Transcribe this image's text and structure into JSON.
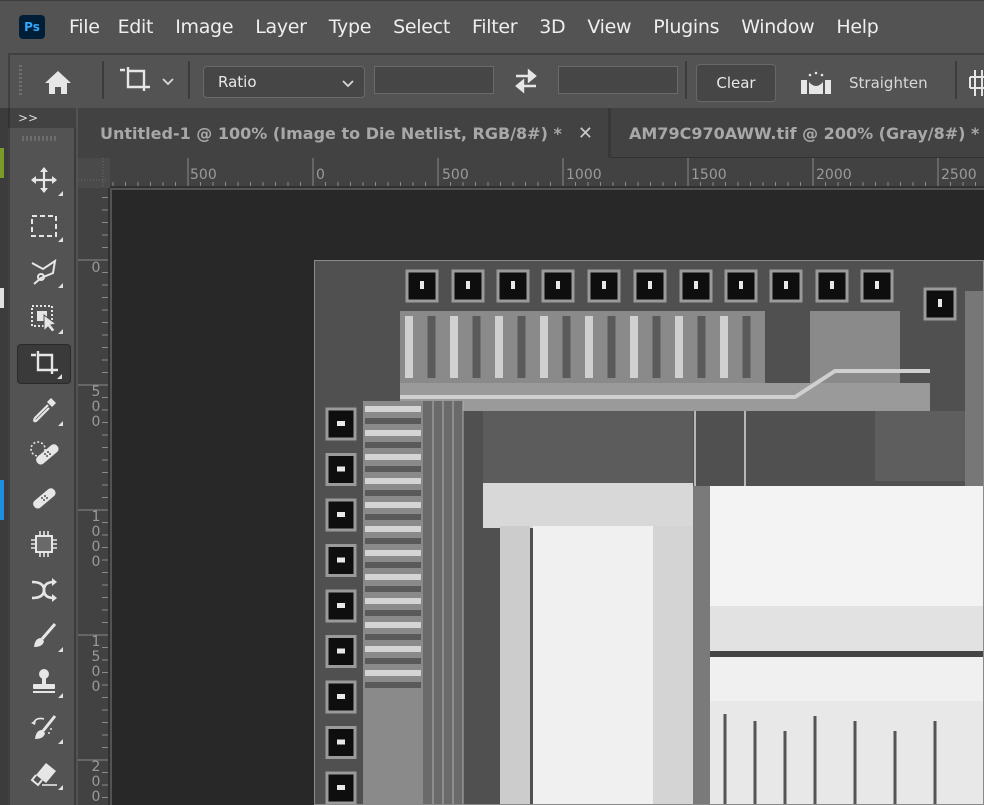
{
  "app": {
    "logo": "Ps",
    "accent": "#31a8ff",
    "logo_bg": "#001e36"
  },
  "menu": {
    "items": [
      "File",
      "Edit",
      "Image",
      "Layer",
      "Type",
      "Select",
      "Filter",
      "3D",
      "View",
      "Plugins",
      "Window",
      "Help"
    ]
  },
  "options_bar": {
    "home_icon": "home-icon",
    "tool_icon": "crop-icon",
    "ratio_select": {
      "value": "Ratio"
    },
    "width_field": {
      "value": ""
    },
    "height_field": {
      "value": ""
    },
    "swap_icon": "swap-arrows-icon",
    "clear_label": "Clear",
    "straighten_label": "Straighten",
    "overlay_icon": "grid-overlay-icon"
  },
  "toolbox": {
    "collapse_label": ">>",
    "tools": [
      {
        "name": "move-tool",
        "icon": "move-icon",
        "has_submenu": true
      },
      {
        "name": "rectangular-marquee-tool",
        "icon": "marquee-icon",
        "has_submenu": true
      },
      {
        "name": "lasso-tool",
        "icon": "polygonal-lasso-icon",
        "has_submenu": true
      },
      {
        "name": "object-selection-tool",
        "icon": "object-selection-icon",
        "has_submenu": true
      },
      {
        "name": "crop-tool",
        "icon": "crop-icon",
        "has_submenu": true,
        "active": true
      },
      {
        "name": "eyedropper-tool",
        "icon": "eyedropper-icon",
        "has_submenu": true
      },
      {
        "name": "spot-healing-brush-tool",
        "icon": "spot-healing-icon",
        "has_submenu": false
      },
      {
        "name": "healing-brush-tool",
        "icon": "bandage-icon",
        "has_submenu": false
      },
      {
        "name": "content-aware-tool",
        "icon": "chip-icon",
        "has_submenu": false
      },
      {
        "name": "content-aware-move-tool",
        "icon": "crossing-arrows-icon",
        "has_submenu": false
      },
      {
        "name": "brush-tool",
        "icon": "brush-icon",
        "has_submenu": true
      },
      {
        "name": "clone-stamp-tool",
        "icon": "stamp-icon",
        "has_submenu": true
      },
      {
        "name": "history-brush-tool",
        "icon": "history-brush-icon",
        "has_submenu": true
      },
      {
        "name": "eraser-tool",
        "icon": "eraser-icon",
        "has_submenu": true
      }
    ]
  },
  "tabs": [
    {
      "title": "Untitled-1 @ 100% (Image to Die Netlist, RGB/8#) *",
      "active": true,
      "closable": true
    },
    {
      "title": "AM79C970AWW.tif @ 200% (Gray/8#) *",
      "active": false,
      "closable": true
    }
  ],
  "rulers": {
    "horizontal": [
      "500",
      "0",
      "500",
      "1000",
      "1500",
      "2000",
      "2500"
    ],
    "vertical": [
      "0",
      "500",
      "1000",
      "1500",
      "200"
    ]
  },
  "document": {
    "content": "grayscale die photograph of integrated circuit"
  }
}
